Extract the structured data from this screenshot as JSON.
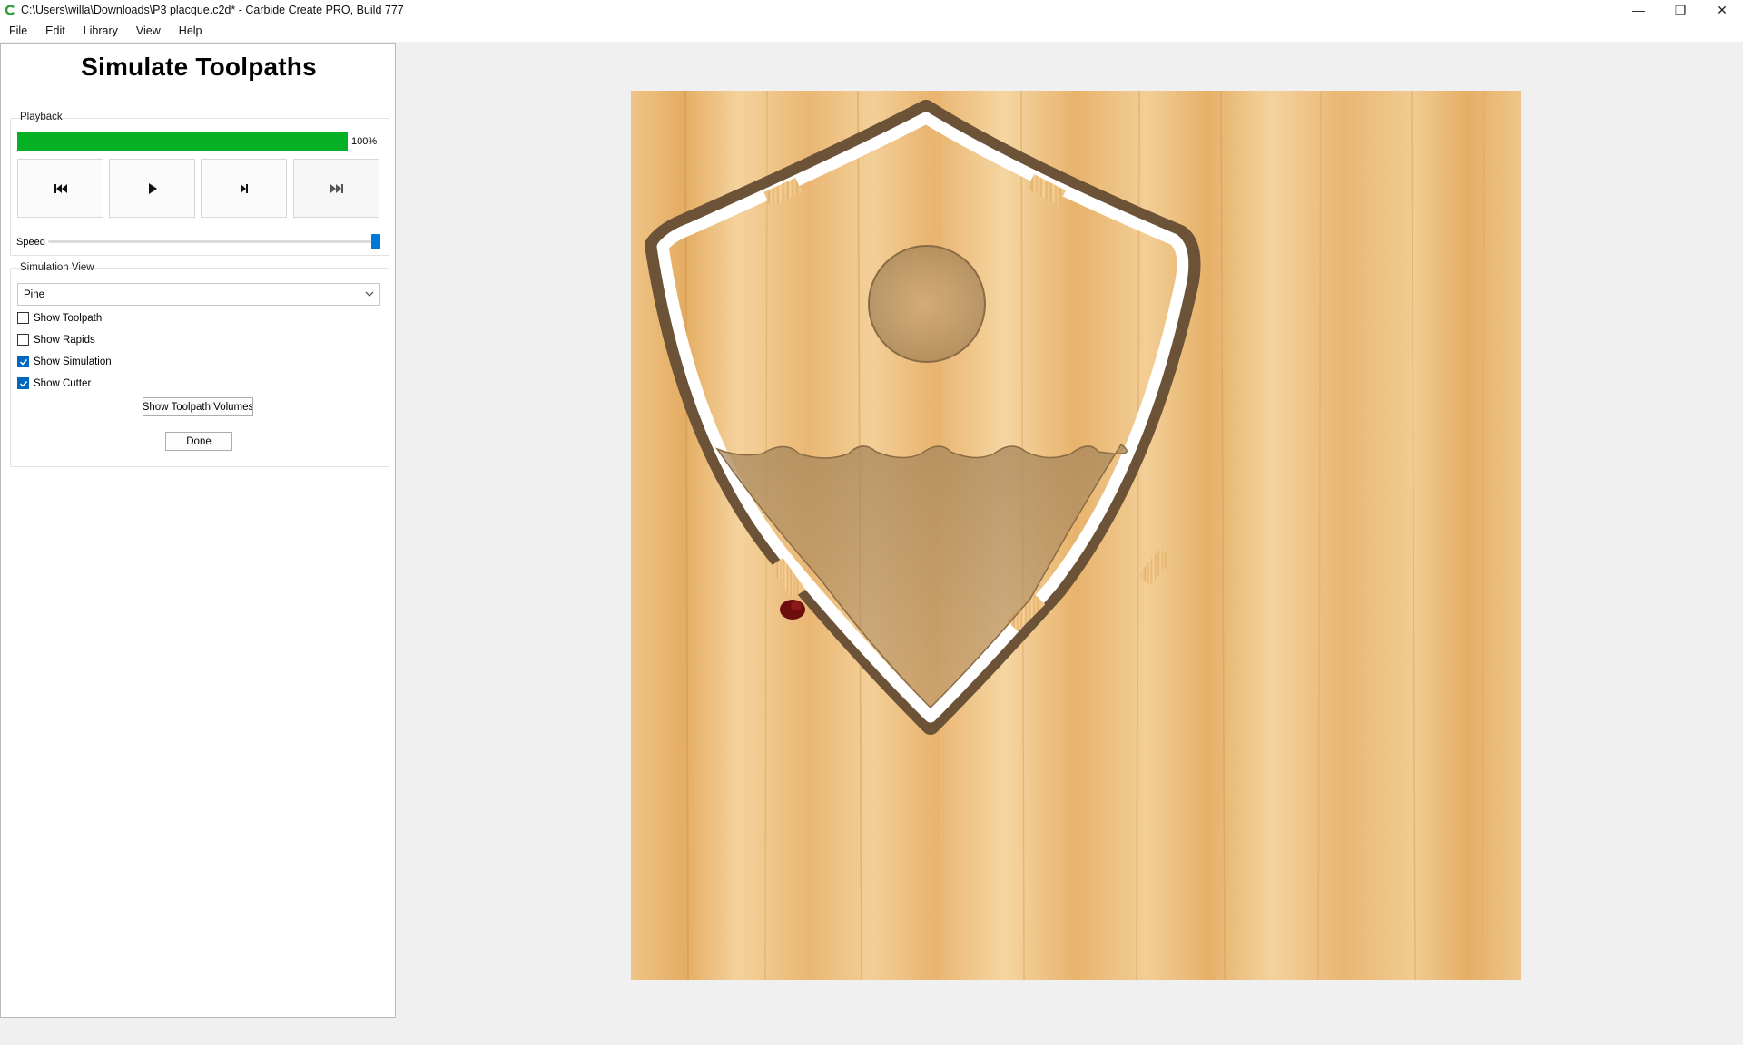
{
  "window": {
    "title": "C:\\Users\\willa\\Downloads\\P3 placque.c2d* - Carbide Create PRO, Build 777",
    "minimize_glyph": "—",
    "restore_glyph": "❐",
    "close_glyph": "✕"
  },
  "menu": {
    "file": "File",
    "edit": "Edit",
    "library": "Library",
    "view": "View",
    "help": "Help"
  },
  "panel": {
    "title": "Simulate Toolpaths",
    "playback": {
      "label": "Playback",
      "progress_text": "100%",
      "progress_value": 1.0,
      "progress_color": "#06b025",
      "speed_label": "Speed",
      "speed_value": 1.0
    },
    "simulation_view": {
      "label": "Simulation View",
      "material": "Pine",
      "show_toolpath": "Show Toolpath",
      "show_rapids": "Show Rapids",
      "show_simulation": "Show Simulation",
      "show_cutter": "Show Cutter",
      "show_toolpath_checked": false,
      "show_rapids_checked": false,
      "show_simulation_checked": true,
      "show_cutter_checked": true,
      "volumes_button": "Show Toolpath Volumes"
    },
    "done_button": "Done"
  },
  "icons": {
    "rewind": "skip-to-start-icon",
    "play": "play-icon",
    "step": "step-forward-icon",
    "fast_forward": "skip-to-end-icon",
    "chevron": "chevron-down-icon",
    "check": "check-icon"
  },
  "colors": {
    "accent": "#0078d7",
    "checkbox": "#0067c0",
    "wood_light": "#f0c98e",
    "wood_dark": "#e6b06a"
  }
}
